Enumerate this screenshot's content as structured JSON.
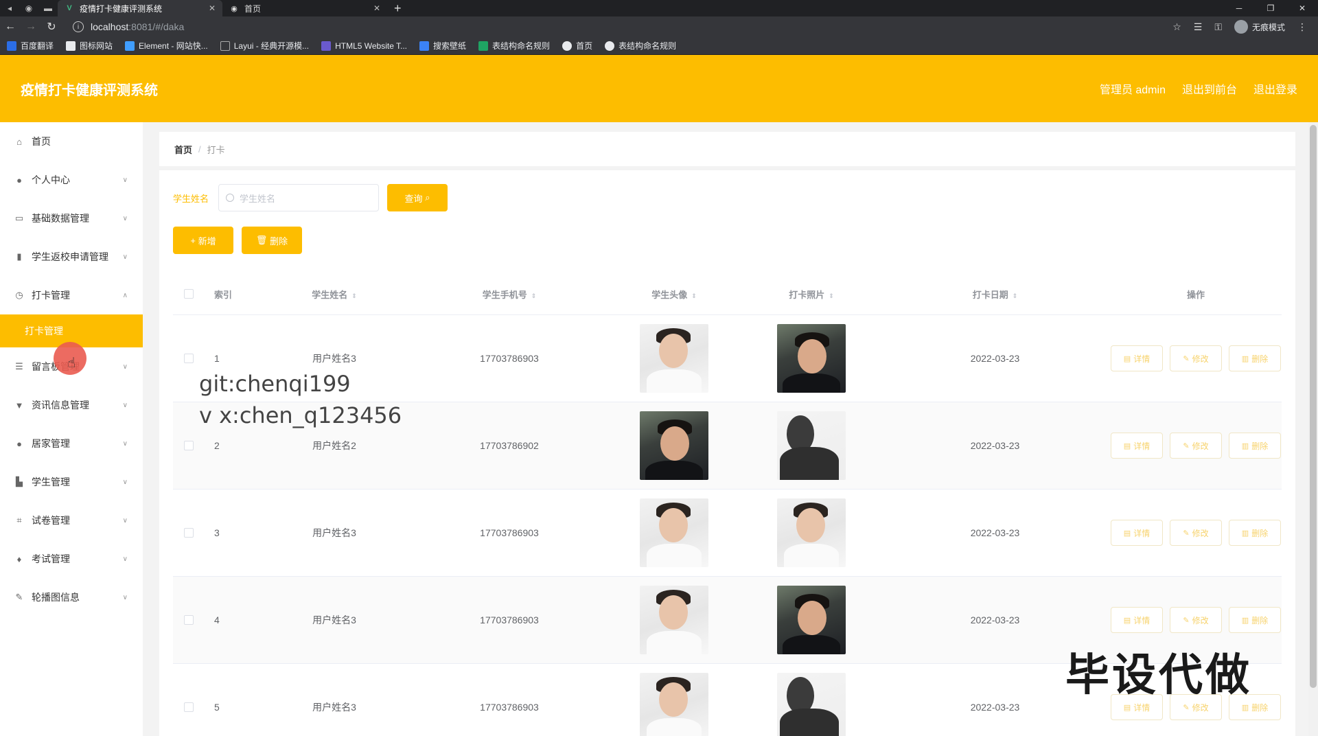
{
  "browser": {
    "tabs": [
      {
        "label": "疫情打卡健康评测系统",
        "active": true
      },
      {
        "label": "首页",
        "active": false
      }
    ],
    "url_host": "localhost",
    "url_path": ":8081/#/daka",
    "profile_label": "无痕模式",
    "bookmarks": [
      "百度翻译",
      "图标网站",
      "Element - 网站快...",
      "Layui - 经典开源模...",
      "HTML5 Website T...",
      "搜索壁纸",
      "表结构命名规则",
      "首页",
      "表结构命名规则"
    ]
  },
  "header": {
    "title": "疫情打卡健康评测系统",
    "admin_label": "管理员 admin",
    "frontend_label": "退出到前台",
    "logout_label": "退出登录"
  },
  "sidebar": {
    "items": [
      {
        "label": "首页",
        "icon": "home-icon"
      },
      {
        "label": "个人中心",
        "icon": "user-icon"
      },
      {
        "label": "基础数据管理",
        "icon": "data-icon"
      },
      {
        "label": "学生返校申请管理",
        "icon": "chart-icon"
      },
      {
        "label": "打卡管理",
        "icon": "clock-icon"
      },
      {
        "label": "留言板管理",
        "icon": "sliders-icon"
      },
      {
        "label": "资讯信息管理",
        "icon": "news-icon"
      },
      {
        "label": "居家管理",
        "icon": "person-icon"
      },
      {
        "label": "学生管理",
        "icon": "student-icon"
      },
      {
        "label": "试卷管理",
        "icon": "crop-icon"
      },
      {
        "label": "考试管理",
        "icon": "mic-icon"
      },
      {
        "label": "轮播图信息",
        "icon": "edit-icon"
      }
    ],
    "active_sub": "打卡管理"
  },
  "breadcrumb": {
    "home": "首页",
    "current": "打卡"
  },
  "search": {
    "label": "学生姓名",
    "placeholder": "学生姓名",
    "query_label": "查询"
  },
  "actions": {
    "add_label": "新增",
    "delete_label": "删除"
  },
  "table": {
    "columns": {
      "index": "索引",
      "name": "学生姓名",
      "phone": "学生手机号",
      "avatar": "学生头像",
      "photo": "打卡照片",
      "date": "打卡日期",
      "ops": "操作"
    },
    "op_labels": {
      "detail": "详情",
      "edit": "修改",
      "delete": "删除"
    },
    "rows": [
      {
        "index": "1",
        "name": "用户姓名3",
        "phone": "17703786903",
        "date": "2022-03-23",
        "avatar": "light",
        "photo": "dark"
      },
      {
        "index": "2",
        "name": "用户姓名2",
        "phone": "17703786902",
        "date": "2022-03-23",
        "avatar": "dark",
        "photo": "shadow"
      },
      {
        "index": "3",
        "name": "用户姓名3",
        "phone": "17703786903",
        "date": "2022-03-23",
        "avatar": "light",
        "photo": "light"
      },
      {
        "index": "4",
        "name": "用户姓名3",
        "phone": "17703786903",
        "date": "2022-03-23",
        "avatar": "light",
        "photo": "dark"
      },
      {
        "index": "5",
        "name": "用户姓名3",
        "phone": "17703786903",
        "date": "2022-03-23",
        "avatar": "light",
        "photo": "shadow"
      }
    ]
  },
  "overlays": {
    "git": "git:chenqi199",
    "vx": "v x:chen_q123456",
    "ad": "毕设代做"
  },
  "colors": {
    "accent": "#fdbd00",
    "header_text": "#ffffff"
  }
}
